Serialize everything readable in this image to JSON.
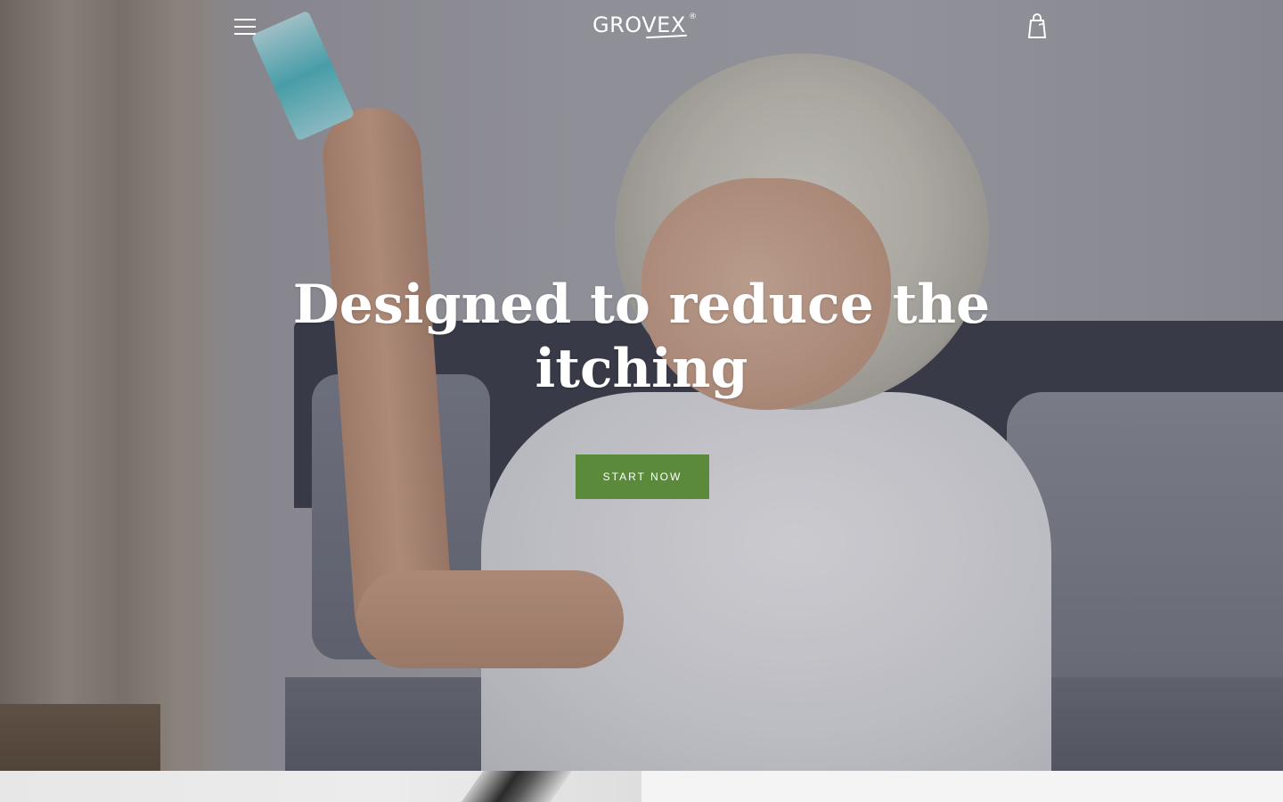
{
  "header": {
    "logo_text": "GROVEX",
    "logo_mark": "®",
    "menu_icon": "hamburger-menu-icon",
    "cart_icon": "shopping-bag-icon"
  },
  "hero": {
    "title": "Designed to reduce the itching",
    "cta_label": "START NOW"
  },
  "colors": {
    "cta_background": "#5a8a3a",
    "text": "#ffffff"
  }
}
